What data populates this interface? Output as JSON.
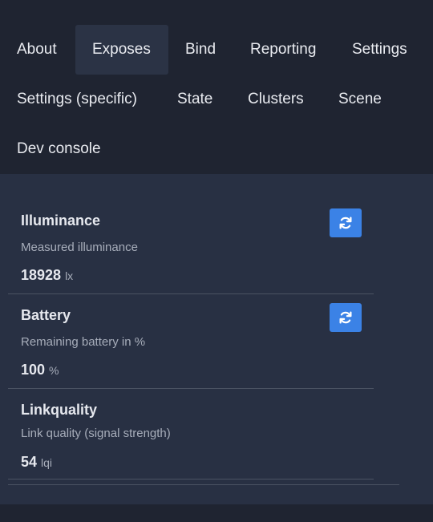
{
  "tabs": [
    {
      "label": "About"
    },
    {
      "label": "Exposes",
      "active": true
    },
    {
      "label": "Bind"
    },
    {
      "label": "Reporting"
    },
    {
      "label": "Settings"
    },
    {
      "label": "Settings (specific)"
    },
    {
      "label": "State"
    },
    {
      "label": "Clusters"
    },
    {
      "label": "Scene"
    },
    {
      "label": "Dev console"
    }
  ],
  "exposes": [
    {
      "name": "Illuminance",
      "description": "Measured illuminance",
      "value": "18928",
      "unit": "lx",
      "refresh_icon": "refresh-icon"
    },
    {
      "name": "Battery",
      "description": "Remaining battery in %",
      "value": "100",
      "unit": "%",
      "refresh_icon": "refresh-icon"
    },
    {
      "name": "Linkquality",
      "description": "Link quality (signal strength)",
      "value": "54",
      "unit": "lqi"
    }
  ],
  "colors": {
    "background": "#1f2431",
    "panel": "#283043",
    "active_tab": "#2b3345",
    "accent": "#3b82e6"
  }
}
